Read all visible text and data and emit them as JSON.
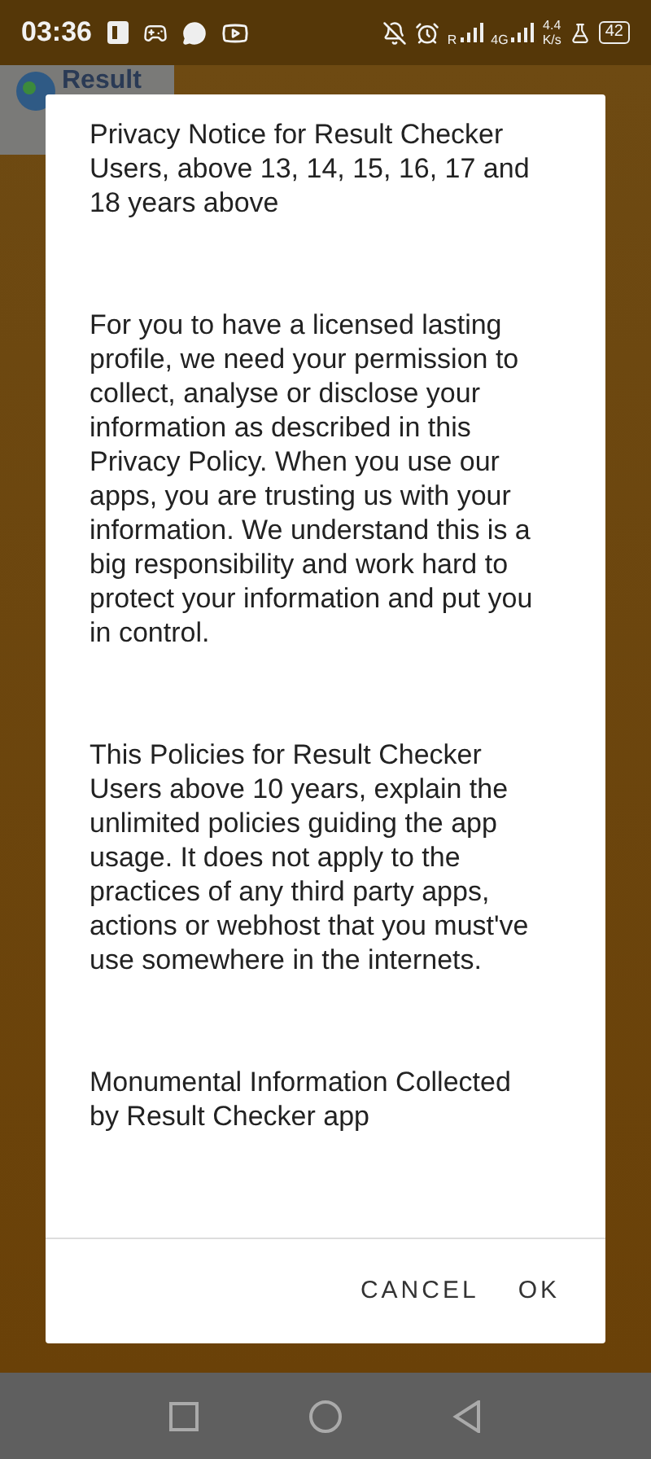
{
  "status_bar": {
    "time": "03:36",
    "signal_label": "R",
    "network": "4G",
    "speed": "4.4",
    "speed_unit": "K/s",
    "battery": "42"
  },
  "app_header": {
    "title": "Result"
  },
  "dialog": {
    "paragraphs": [
      "Privacy Notice for Result Checker Users, above 13, 14, 15, 16, 17 and 18 years above",
      "For you to have a licensed lasting profile, we need your permission to collect, analyse or disclose your information as described in this Privacy Policy. When you use our apps, you are trusting us with your information. We understand this is a big responsibility and work hard to protect your information and put you in control.",
      "This Policies for Result Checker Users above 10 years, explain the unlimited policies guiding the app usage. It does not apply to the practices of any third party apps, actions or webhost that you must've use somewhere in the internets.",
      "Monumental Information Collected by Result Checker app"
    ],
    "buttons": [
      "CANCEL",
      "OK"
    ]
  }
}
